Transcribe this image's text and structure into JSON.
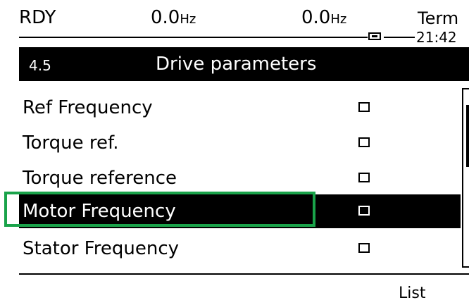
{
  "status": {
    "state": "RDY",
    "ref_value": "0.0",
    "ref_unit": "Hz",
    "out_value": "0.0",
    "out_unit": "Hz",
    "channel": "Term",
    "time": "21:42"
  },
  "menu": {
    "code": "4.5",
    "title": "Drive parameters"
  },
  "parameters": [
    {
      "label": "Ref Frequency",
      "selected": false
    },
    {
      "label": "Torque ref.",
      "selected": false
    },
    {
      "label": "Torque reference",
      "selected": false
    },
    {
      "label": "Motor Frequency",
      "selected": true
    },
    {
      "label": "Stator Frequency",
      "selected": false
    }
  ],
  "softkeys": {
    "f4": "List"
  },
  "colors": {
    "highlight": "#1aa34a",
    "foreground": "#000000",
    "background": "#ffffff"
  }
}
